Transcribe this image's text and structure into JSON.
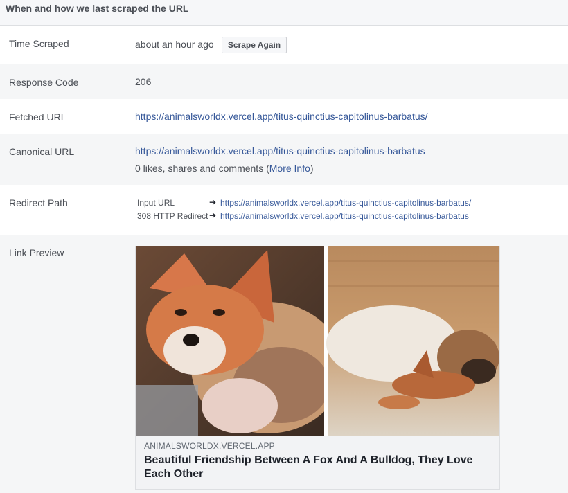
{
  "header": {
    "title": "When and how we last scraped the URL"
  },
  "time_scraped": {
    "label": "Time Scraped",
    "value": "about an hour ago",
    "button": "Scrape Again"
  },
  "response_code": {
    "label": "Response Code",
    "value": "206"
  },
  "fetched_url": {
    "label": "Fetched URL",
    "value": "https://animalsworldx.vercel.app/titus-quinctius-capitolinus-barbatus/"
  },
  "canonical_url": {
    "label": "Canonical URL",
    "value": "https://animalsworldx.vercel.app/titus-quinctius-capitolinus-barbatus",
    "engagement_prefix": "0 likes, shares and comments (",
    "more_info": "More Info",
    "engagement_suffix": ")"
  },
  "redirect_path": {
    "label": "Redirect Path",
    "steps": [
      {
        "type": "Input URL",
        "arrow": "➔",
        "url": "https://animalsworldx.vercel.app/titus-quinctius-capitolinus-barbatus/"
      },
      {
        "type": "308 HTTP Redirect",
        "arrow": "➔",
        "url": "https://animalsworldx.vercel.app/titus-quinctius-capitolinus-barbatus"
      }
    ]
  },
  "link_preview": {
    "label": "Link Preview",
    "domain": "ANIMALSWORLDX.VERCEL.APP",
    "title": "Beautiful Friendship Between A Fox And A Bulldog, They Love Each Other"
  },
  "colors": {
    "link": "#365899",
    "label_text": "#4b4f56",
    "alt_row_bg": "#f5f6f7"
  }
}
